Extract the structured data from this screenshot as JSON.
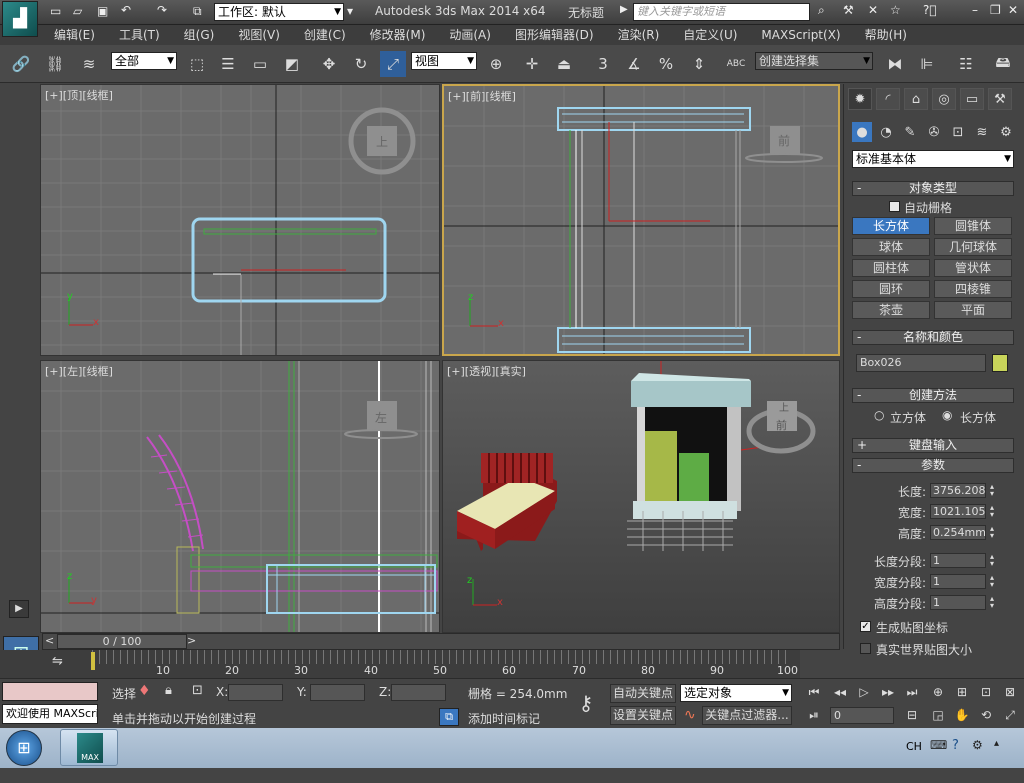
{
  "titlebar": {
    "workspace": "工作区: 默认",
    "app_title": "Autodesk 3ds Max  2014 x64",
    "doc_title": "无标题",
    "search_placeholder": "键入关键字或短语"
  },
  "menu": [
    "编辑(E)",
    "工具(T)",
    "组(G)",
    "视图(V)",
    "创建(C)",
    "修改器(M)",
    "动画(A)",
    "图形编辑器(D)",
    "渲染(R)",
    "自定义(U)",
    "MAXScript(X)",
    "帮助(H)"
  ],
  "toolbar": {
    "filter": "全部",
    "refcoord": "视图",
    "selection_set": "创建选择集",
    "snap_label": "3",
    "abc_label": "ABC"
  },
  "viewports": {
    "top": {
      "label": "[+][顶][线框]",
      "cube": "上"
    },
    "front": {
      "label": "[+][前][线框]",
      "cube": "前"
    },
    "left": {
      "label": "[+][左][线框]",
      "cube": "左"
    },
    "persp": {
      "label": "[+][透视][真实]",
      "cube": "前",
      "cube_top": "上"
    }
  },
  "axis": {
    "x": "x",
    "y": "y",
    "z": "z"
  },
  "command_panel": {
    "category": "标准基本体",
    "object_type": {
      "title": "对象类型",
      "autogrid": "自动栅格",
      "buttons": [
        "长方体",
        "圆锥体",
        "球体",
        "几何球体",
        "圆柱体",
        "管状体",
        "圆环",
        "四棱锥",
        "茶壶",
        "平面"
      ]
    },
    "name_color": {
      "title": "名称和颜色",
      "name": "Box026",
      "color": "#c8d45a"
    },
    "creation": {
      "title": "创建方法",
      "cube": "立方体",
      "box": "长方体"
    },
    "keyboard": {
      "title": "键盘输入"
    },
    "params": {
      "title": "参数",
      "length_label": "长度:",
      "length": "3756.208",
      "width_label": "宽度:",
      "width": "1021.105",
      "height_label": "高度:",
      "height": "0.254mm",
      "lseg_label": "长度分段:",
      "lseg": "1",
      "wseg_label": "宽度分段:",
      "wseg": "1",
      "hseg_label": "高度分段:",
      "hseg": "1",
      "gen_map": "生成贴图坐标",
      "real_world": "真实世界贴图大小"
    },
    "signs": {
      "minus": "-",
      "plus": "+"
    }
  },
  "timeline": {
    "position": "0 / 100",
    "ticks": [
      "10",
      "20",
      "30",
      "40",
      "50",
      "60",
      "70",
      "80",
      "90",
      "100"
    ]
  },
  "status": {
    "welcome": "欢迎使用 MAXScri",
    "select_label": "选择",
    "prompt": "单击并拖动以开始创建过程",
    "x_label": "X:",
    "y_label": "Y:",
    "z_label": "Z:",
    "grid": "栅格 = 254.0mm",
    "autokey": "自动关键点",
    "setkey": "设置关键点",
    "key_target": "选定对象",
    "add_tag": "添加时间标记",
    "key_filter": "关键点过滤器...",
    "frame": "0"
  },
  "taskbar": {
    "lang": "CH",
    "app_label": "MAX"
  }
}
